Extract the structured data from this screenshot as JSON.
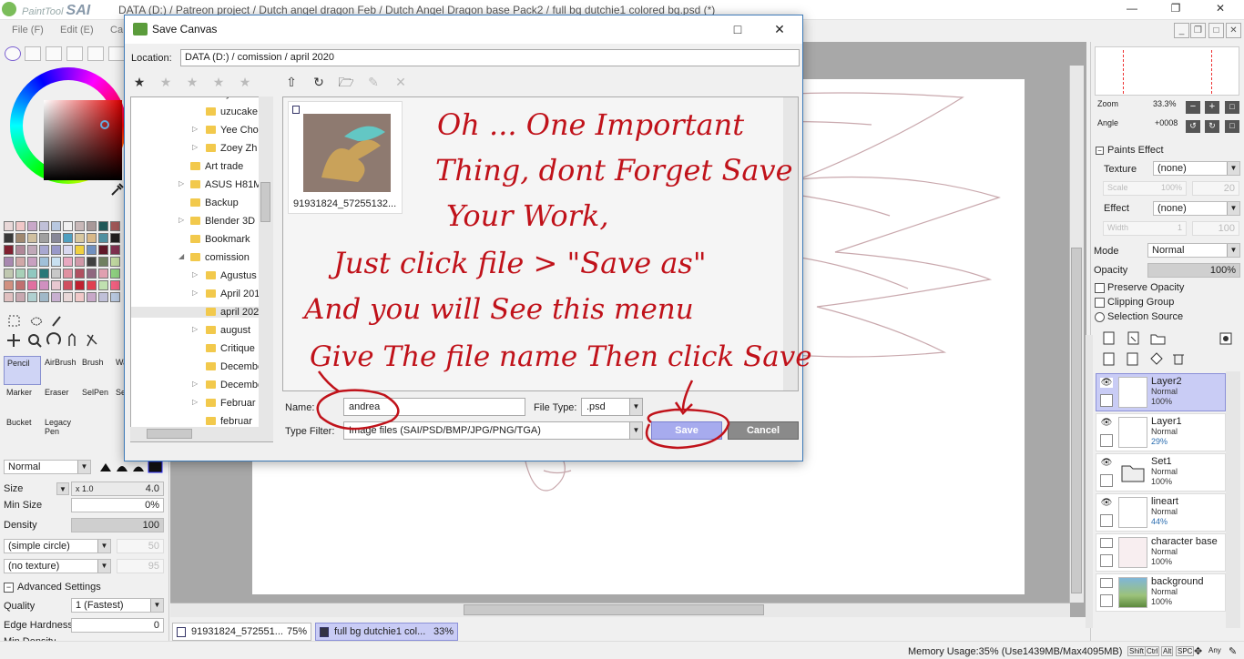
{
  "titlebar": {
    "app_prefix": "PaintTool",
    "app_name": "SAI",
    "path": "DATA (D:) / Patreon project / Dutch angel dragon Feb / Dutch Angel Dragon base Pack2 / full bg dutchie1 colored bg.psd (*)"
  },
  "menubar": {
    "items": [
      "File (F)",
      "Edit (E)",
      "Ca"
    ]
  },
  "tools": {
    "cells": [
      {
        "label": "Pencil"
      },
      {
        "label": "AirBrush"
      },
      {
        "label": "Brush"
      },
      {
        "label": "Wa"
      },
      {
        "label": "Marker"
      },
      {
        "label": "Eraser"
      },
      {
        "label": "SelPen"
      },
      {
        "label": "Se"
      },
      {
        "label": "Bucket"
      },
      {
        "label": "Legacy Pen"
      }
    ]
  },
  "brush": {
    "mode": "Normal",
    "size_label": "Size",
    "size_mult": "x 1.0",
    "size_value": "4.0",
    "min_size_label": "Min Size",
    "min_size_value": "0%",
    "density_label": "Density",
    "density_value": "100",
    "shape": "(simple circle)",
    "shape_value": "50",
    "texture": "(no texture)",
    "texture_value": "95",
    "advanced_label": "Advanced Settings",
    "quality_label": "Quality",
    "quality_value": "1 (Fastest)",
    "edge_label": "Edge Hardness",
    "edge_value": "0",
    "min_density_label": "Min Density"
  },
  "navigator": {
    "zoom_label": "Zoom",
    "zoom_value": "33.3%",
    "angle_label": "Angle",
    "angle_value": "+0008"
  },
  "paints_effect": {
    "header": "Paints Effect",
    "texture_label": "Texture",
    "texture_value": "(none)",
    "scale_label": "Scale",
    "scale_value": "100%",
    "scale_num": "20",
    "effect_label": "Effect",
    "effect_value": "(none)",
    "width_label": "Width",
    "width_value": "1",
    "width_num": "100"
  },
  "layer_props": {
    "mode_label": "Mode",
    "mode_value": "Normal",
    "opacity_label": "Opacity",
    "opacity_value": "100%",
    "preserve_opacity": "Preserve Opacity",
    "clipping_group": "Clipping Group",
    "selection_source": "Selection Source"
  },
  "layers": [
    {
      "name": "Layer2",
      "mode": "Normal",
      "opacity": "100%",
      "selected": true
    },
    {
      "name": "Layer1",
      "mode": "Normal",
      "opacity": "29%"
    },
    {
      "name": "Set1",
      "mode": "Normal",
      "opacity": "100%"
    },
    {
      "name": "lineart",
      "mode": "Normal",
      "opacity": "44%"
    },
    {
      "name": "character base",
      "mode": "Normal",
      "opacity": "100%"
    },
    {
      "name": "background",
      "mode": "Normal",
      "opacity": "100%"
    }
  ],
  "doc_tabs": [
    {
      "label": "91931824_572551...",
      "zoom": "75%"
    },
    {
      "label": "full bg dutchie1 col...",
      "zoom": "33%"
    }
  ],
  "statusbar": {
    "memory": "Memory Usage:35% (Use1439MB/Max4095MB)",
    "keys": [
      "Shift",
      "Ctrl",
      "Alt",
      "SPC",
      "Any"
    ]
  },
  "dialog": {
    "title": "Save Canvas",
    "location_label": "Location:",
    "location_value": "DATA (D:) / comission / april 2020",
    "tree": [
      "Tyi",
      "uzucake",
      "Yee Cho",
      "Zoey Zh",
      "Art trade",
      "ASUS H81M",
      "Backup",
      "Blender 3D",
      "Bookmark",
      "comission",
      "Agustus",
      "April 201",
      "april 202",
      "august",
      "Critique",
      "Decembe",
      "Decembe",
      "Februar",
      "februar"
    ],
    "file_name": "91931824_57255132...",
    "name_label": "Name:",
    "name_value": "andrea",
    "filetype_label": "File Type:",
    "filetype_value": ".psd",
    "filter_label": "Type Filter:",
    "filter_value": "Image files (SAI/PSD/BMP/JPG/PNG/TGA)",
    "save_label": "Save",
    "cancel_label": "Cancel"
  },
  "note_lines": [
    "Oh ...  One Important",
    "Thing, dont Forget Save",
    "Your Work,",
    "Just click file > \"Save as\"",
    "And you will See this menu",
    "Give The file name Then click Save"
  ],
  "colors": {
    "accent": "#a7abee",
    "note": "#c0121a",
    "dialog_border": "#3d7ab8"
  }
}
